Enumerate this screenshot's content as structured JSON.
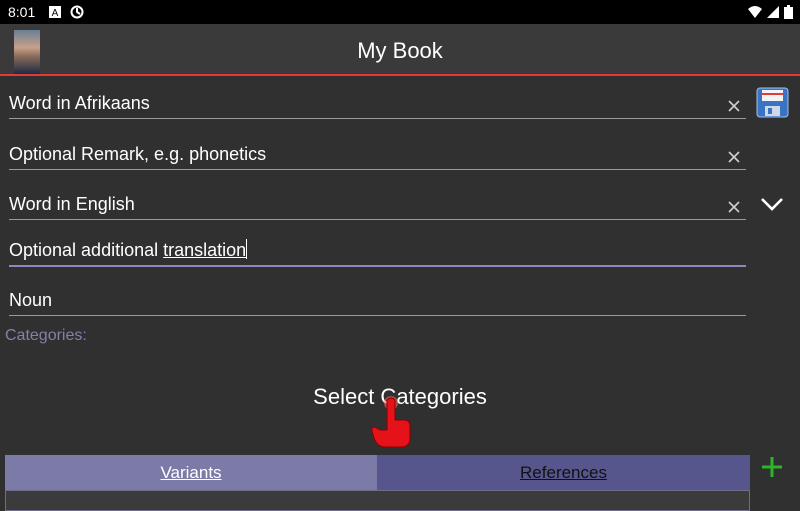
{
  "status": {
    "time": "8:01"
  },
  "appbar": {
    "title": "My Book"
  },
  "form": {
    "word_source": "Word in Afrikaans",
    "remark": "Optional Remark, e.g. phonetics",
    "word_target": "Word in English",
    "additional_prefix": "Optional additional ",
    "additional_word": "translation",
    "word_type": "Noun"
  },
  "categories": {
    "label": "Categories:",
    "select_label": "Select Categories"
  },
  "tabs": [
    {
      "label": "Variants"
    },
    {
      "label": "References"
    }
  ],
  "colors": {
    "accent": "#e53935",
    "tab_active": "#7c7aa6",
    "tab_inactive": "#57568c",
    "add": "#2db42d"
  }
}
